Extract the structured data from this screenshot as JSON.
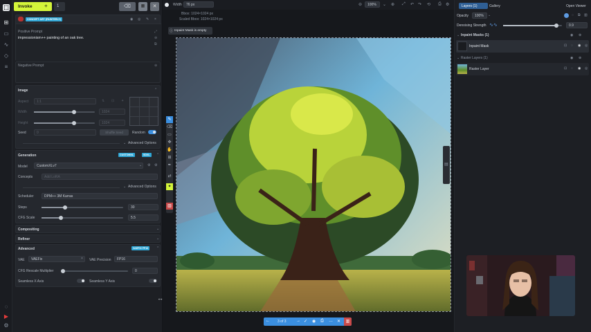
{
  "app": {
    "invoke_label": "Invoke",
    "batch_count": "1",
    "width_label": "Width",
    "width_value": "76 px",
    "zoom": "100%",
    "bbox": "Bbox: 1024×1024 px",
    "scaled_bbox": "Scaled Bbox: 1024×1024 px",
    "inpaint_notice": "Inpaint Mask is empty",
    "pager": "3 of 3"
  },
  "left": {
    "concept_tag": "CONCEPT ART (PAINTERLY)",
    "positive_label": "Positive Prompt",
    "positive_value": "impressionism++ painting of an oak tree.",
    "negative_label": "Negative Prompt",
    "image": {
      "title": "Image",
      "aspect_label": "Aspect",
      "aspect_value": "1:1",
      "width_label": "Width",
      "width_value": "1024",
      "height_label": "Height",
      "height_value": "1024",
      "seed_label": "Seed",
      "seed_value": "0",
      "shuffle_label": "Shuffle Seed",
      "random_label": "Random",
      "advanced_label": "Advanced Options"
    },
    "generation": {
      "title": "Generation",
      "tag1": "CUSTOMXL",
      "tag2": "SDXL",
      "model_label": "Model",
      "model_value": "CustomXLv7",
      "concepts_label": "Concepts",
      "concepts_placeholder": "Add LoRA",
      "advanced_label": "Advanced Options",
      "scheduler_label": "Scheduler",
      "scheduler_value": "DPM++ 3M Karras",
      "steps_label": "Steps",
      "steps_value": "30",
      "steps_fraction": 0.29,
      "cfg_label": "CFG Scale",
      "cfg_value": "5.5",
      "cfg_fraction": 0.24
    },
    "compositing_label": "Compositing",
    "refiner_label": "Refiner",
    "advanced": {
      "title": "Advanced",
      "tag": "VAEFIX FP16",
      "vae_label": "VAE",
      "vae_value": "VAEFix",
      "vae_precision_label": "VAE Precision",
      "vae_precision_value": "FP16",
      "rescale_label": "CFG Rescale Multiplier",
      "rescale_value": "0",
      "seamless_x": "Seamless X Axis",
      "seamless_y": "Seamless Y Axis"
    }
  },
  "right": {
    "tab_layers": "Layers (1)",
    "tab_gallery": "Gallery",
    "open_viewer": "Open Viewer",
    "opacity_label": "Opacity",
    "opacity_value": "100%",
    "denoise_label": "Denoising Strength",
    "denoise_value": "0.9",
    "denoise_fraction": 0.9,
    "inpaint_group": "Inpaint Masks (1)",
    "inpaint_item": "Inpaint Mask",
    "raster_group": "Raster Layers (1)",
    "raster_item": "Raster Layer"
  },
  "colors": {
    "accent": "#d4f53a",
    "blue": "#3b8fe0",
    "panel": "#1d1f24"
  }
}
